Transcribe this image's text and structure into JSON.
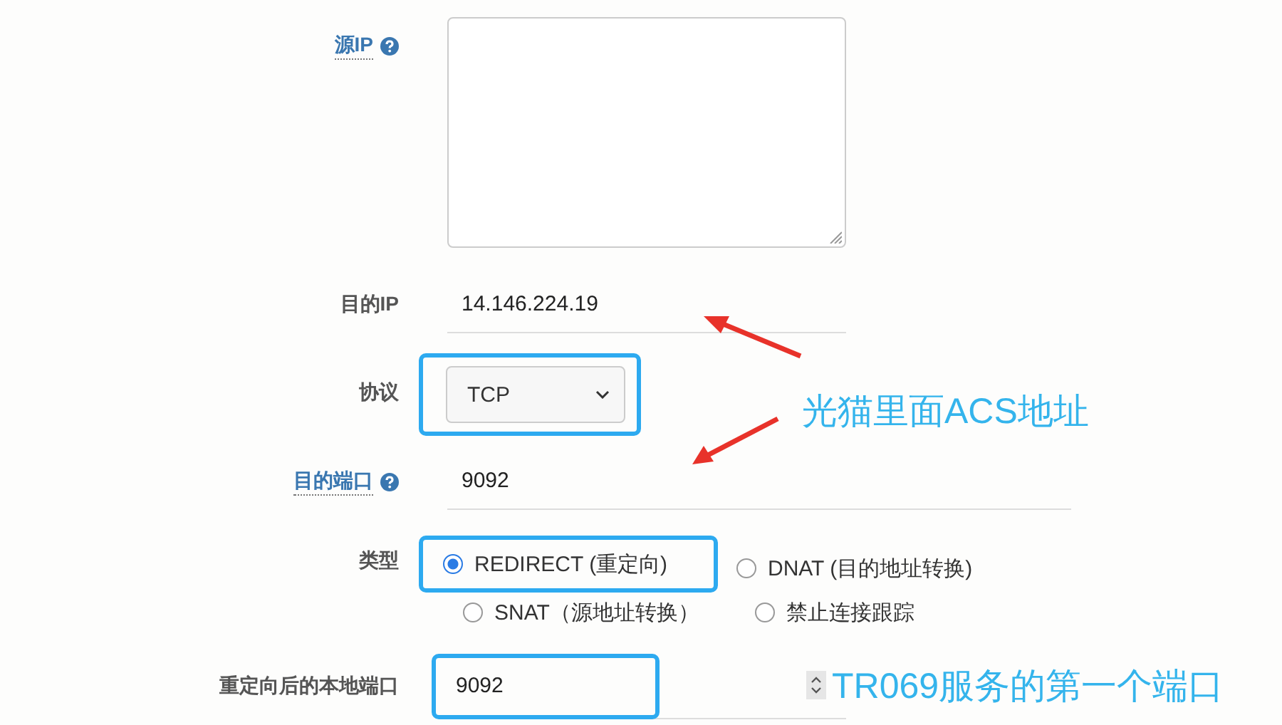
{
  "fields": [
    {
      "kind": "textarea",
      "label": "源IP",
      "help": true
    },
    {
      "kind": "text",
      "label": "目的IP",
      "help": false,
      "value": "14.146.224.19"
    },
    {
      "kind": "select",
      "label": "协议",
      "help": false,
      "value": "TCP",
      "highlighted": true
    },
    {
      "kind": "text",
      "label": "目的端口",
      "help": true,
      "value": "9092"
    },
    {
      "kind": "radio",
      "label": "类型",
      "help": false,
      "options": [
        {
          "label": "REDIRECT (重定向)",
          "selected": true,
          "highlighted": true
        },
        {
          "label": "DNAT (目的地址转换)",
          "selected": false,
          "highlighted": false
        },
        {
          "label": "SNAT（源地址转换）",
          "selected": false,
          "highlighted": false
        },
        {
          "label": "禁止连接跟踪",
          "selected": false,
          "highlighted": false
        }
      ]
    },
    {
      "kind": "number",
      "label": "重定向后的本地端口",
      "help": false,
      "value": "9092",
      "highlighted": true
    }
  ],
  "annotations": [
    {
      "text": "光猫里面ACS地址"
    },
    {
      "text": "TR069服务的第一个端口"
    }
  ]
}
